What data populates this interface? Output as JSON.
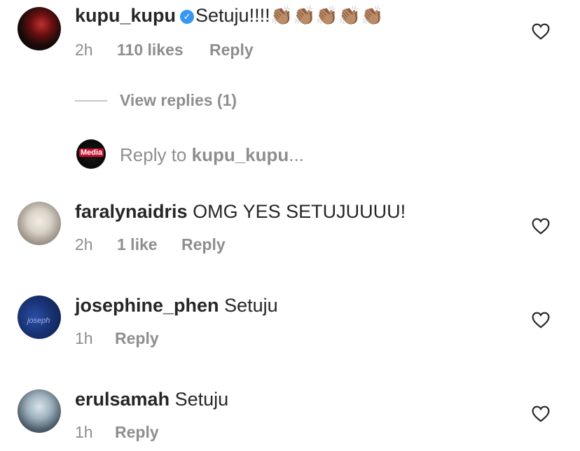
{
  "comments": [
    {
      "username": "kupu_kupu",
      "verified": true,
      "text": "Setuju!!!!",
      "emoji": "👏🏽👏🏽👏🏽👏🏽👏🏽",
      "time": "2h",
      "likes": "110 likes",
      "reply_label": "Reply"
    },
    {
      "username": "faralynaidris",
      "text": "OMG YES SETUJUUUU!",
      "time": "2h",
      "likes": "1 like",
      "reply_label": "Reply"
    },
    {
      "username": "josephine_phen",
      "text": "Setuju",
      "time": "1h",
      "reply_label": "Reply",
      "avatar_text": "joseph"
    },
    {
      "username": "erulsamah",
      "text": "Setuju",
      "time": "1h",
      "reply_label": "Reply"
    }
  ],
  "view_replies": "View replies (1)",
  "reply_box": {
    "prefix": "Reply to ",
    "username": "kupu_kupu",
    "suffix": "...",
    "avatar_label": "Media"
  },
  "icons": {
    "verified": "verified-badge-icon",
    "heart": "heart-outline-icon"
  },
  "colors": {
    "text": "#262626",
    "secondary": "#8e8e8e",
    "verified": "#3897f0"
  }
}
